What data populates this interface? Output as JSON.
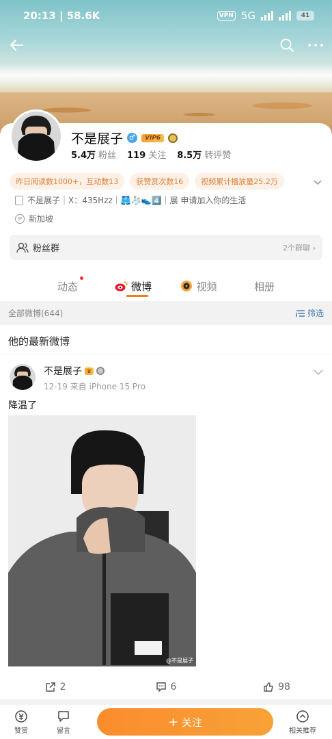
{
  "status_bar": {
    "time_speed": "20:13 | 58.6K",
    "network": "5G",
    "vpn": "VPN",
    "battery": "41"
  },
  "profile": {
    "name": "不是展子",
    "vip": "VIP6",
    "gender": "♂",
    "stats": [
      {
        "value": "5.4万",
        "label": "粉丝"
      },
      {
        "value": "119",
        "label": "关注"
      },
      {
        "value": "8.5万",
        "label": "转评赞"
      }
    ],
    "tags": [
      "昨日阅读数1000+，互动数13",
      "获赞赏次数16",
      "视频累计播放量25.2万"
    ],
    "bio": "不是展子｜X：435Hzz｜🩳🧦👟4️⃣｜展 申请加入你的生活",
    "location": "新加坡",
    "fan_group": {
      "label": "粉丝群",
      "count": "2个群聊"
    }
  },
  "tabs": [
    {
      "label": "动态",
      "active": false,
      "has_dot": true
    },
    {
      "label": "微博",
      "active": true,
      "has_dot": false
    },
    {
      "label": "视频",
      "active": false,
      "has_dot": false
    },
    {
      "label": "相册",
      "active": false,
      "has_dot": false
    }
  ],
  "filter": {
    "label": "全部微博(644)",
    "action": "筛选"
  },
  "section_title": "他的最新微博",
  "post": {
    "author": "不是展子",
    "date_source": "12-19   来自 iPhone 15 Pro",
    "text": "降温了",
    "watermark": "@不是展子",
    "reposts": "2",
    "comments": "6",
    "likes": "98"
  },
  "bottom_bar": {
    "reward": "赞赏",
    "message": "留言",
    "follow": "关注",
    "related": "相关推荐"
  },
  "colors": {
    "accent": "#f07b22",
    "follow_button": "#fb8c2c",
    "tag_bg": "#fdf0e6",
    "link": "#4a7db8"
  }
}
